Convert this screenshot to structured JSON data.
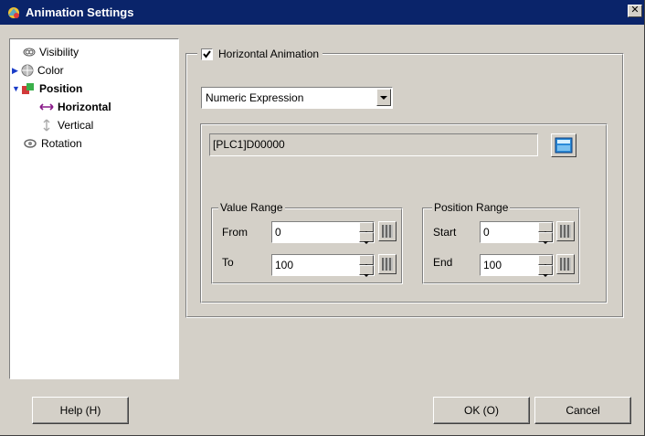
{
  "window": {
    "title": "Animation Settings",
    "close_glyph": "✕"
  },
  "tree": {
    "items": [
      {
        "label": "Visibility",
        "icon": "visibility-icon"
      },
      {
        "label": "Color",
        "icon": "color-icon",
        "collapsed": true
      },
      {
        "label": "Position",
        "icon": "position-icon",
        "expanded": true,
        "selected_parent": true
      },
      {
        "label": "Horizontal",
        "icon": "horizontal-arrow-icon",
        "selected": true
      },
      {
        "label": "Vertical",
        "icon": "vertical-arrow-icon"
      },
      {
        "label": "Rotation",
        "icon": "rotation-icon"
      }
    ]
  },
  "horizontal_animation": {
    "checkbox_label": "Horizontal Animation",
    "checked": true,
    "mode_select": {
      "value": "Numeric Expression"
    },
    "address": "[PLC1]D00000",
    "value_range": {
      "label": "Value Range",
      "from_label": "From",
      "from_value": "0",
      "to_label": "To",
      "to_value": "100"
    },
    "position_range": {
      "label": "Position Range",
      "start_label": "Start",
      "start_value": "0",
      "end_label": "End",
      "end_value": "100"
    }
  },
  "buttons": {
    "help": "Help (H)",
    "ok": "OK (O)",
    "cancel": "Cancel"
  },
  "colors": {
    "titlebar": "#0a246a",
    "dialog_bg": "#d4d0c8",
    "accent_blue": "#1a3cc8"
  }
}
